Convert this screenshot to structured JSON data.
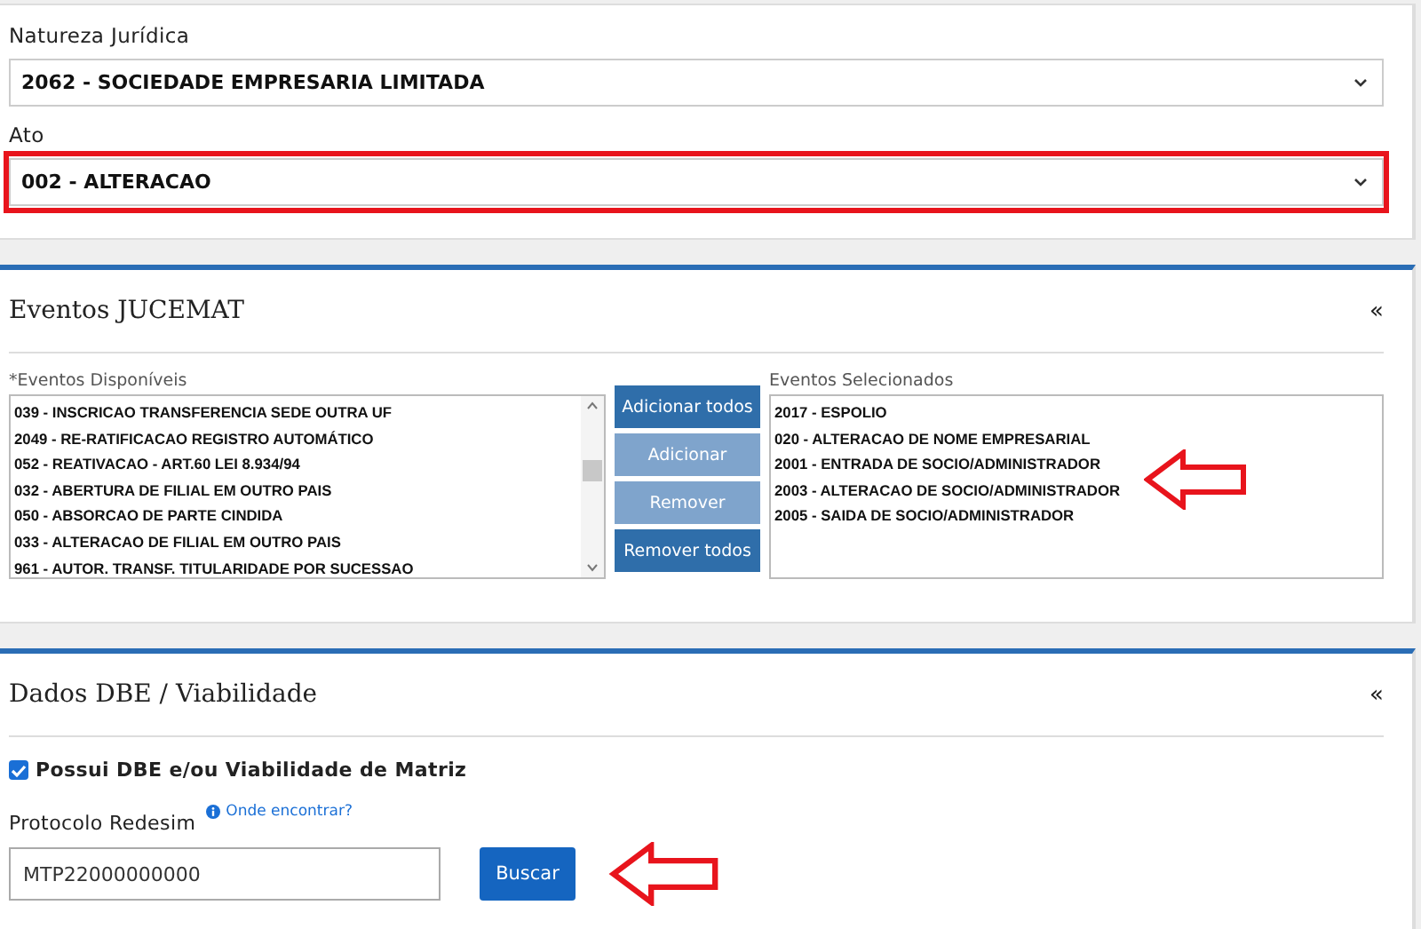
{
  "form": {
    "fields": [
      {
        "label": "Natureza Jurídica",
        "value": "2062 - SOCIEDADE EMPRESARIA LIMITADA",
        "highlighted": false
      },
      {
        "label": "Ato",
        "value": "002 - ALTERACAO",
        "highlighted": true
      }
    ]
  },
  "eventos": {
    "title": "Eventos JUCEMAT",
    "collapse": "«",
    "available": {
      "label": "*Eventos Disponíveis",
      "items": [
        "039 - INSCRICAO TRANSFERENCIA SEDE OUTRA UF",
        "2049 - RE-RATIFICACAO REGISTRO AUTOMÁTICO",
        "052 - REATIVACAO - ART.60 LEI 8.934/94",
        "032 - ABERTURA DE FILIAL EM OUTRO PAIS",
        "050 - ABSORCAO DE PARTE CINDIDA",
        "033 - ALTERACAO DE FILIAL EM OUTRO PAIS",
        "961 - AUTOR. TRANSF. TITULARIDADE POR SUCESSAO"
      ]
    },
    "buttons": [
      {
        "label": "Adicionar todos",
        "disabled": false
      },
      {
        "label": "Adicionar",
        "disabled": true
      },
      {
        "label": "Remover",
        "disabled": true
      },
      {
        "label": "Remover todos",
        "disabled": false
      }
    ],
    "selected_events": {
      "label": "Eventos Selecionados",
      "arrow": true,
      "items": [
        "2017 - ESPOLIO",
        "020 - ALTERACAO DE NOME EMPRESARIAL",
        "2001 - ENTRADA DE SOCIO/ADMINISTRADOR",
        "2003 - ALTERACAO DE SOCIO/ADMINISTRADOR",
        "2005 - SAIDA DE SOCIO/ADMINISTRADOR"
      ]
    }
  },
  "dbe": {
    "title": "Dados DBE / Viabilidade",
    "collapse": "«",
    "checkbox": {
      "label": "Possui DBE e/ou Viabilidade de Matriz",
      "checked": true
    },
    "protocolo": {
      "label": "Protocolo Redesim",
      "help": "Onde encontrar?",
      "value": "MTP22000000000"
    },
    "search_button": {
      "label": "Buscar",
      "arrow": true
    }
  }
}
